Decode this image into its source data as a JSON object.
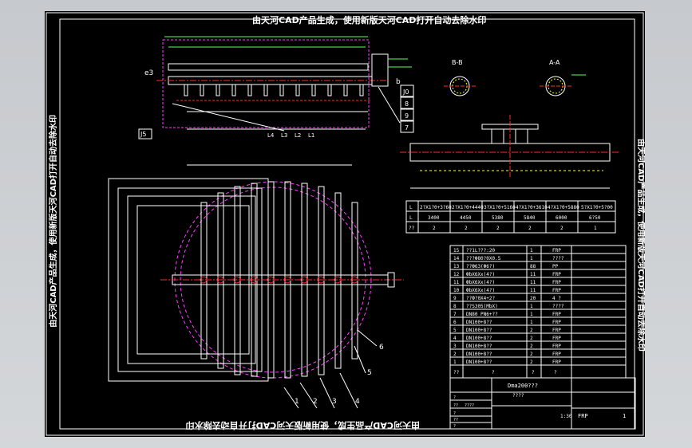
{
  "watermark": {
    "top": "由天河CAD产品生成，使用新版天河CAD打开自动去除水印",
    "bottom": "由天河CAD产品生成，使用新版天河CAD打开自动去除水印",
    "left": "由天河CAD产品生成，使用新版天河CAD打开自动去除水印",
    "right": "由天河CAD产品生成，使用新版天河CAD打开自动去除水印"
  },
  "sections": {
    "bb": "B-B",
    "aa": "A-A"
  },
  "side_labels": {
    "e3": "e3",
    "b": "b",
    "j0": "J0",
    "n8": "8",
    "n7": "7",
    "n9": "9",
    "j5": "J5",
    "l4": "L4",
    "l3": "L3",
    "l2": "L2",
    "l1": "L1"
  },
  "callouts": [
    "1",
    "2",
    "3",
    "4",
    "5",
    "6"
  ],
  "dimension_table": {
    "headers": [
      "L",
      "2?X1?0+3?60",
      "2?X1?0+4440",
      "3?X1?0+5160",
      "4?X1?0+3610",
      "4?X1?0+5880",
      "5?X1?0+5?00"
    ],
    "row1": [
      "L",
      "3400",
      "4450",
      "5380",
      "5840",
      "6000",
      "6?50"
    ],
    "row2": [
      "??",
      "2",
      "2",
      "2",
      "2",
      "2",
      "1"
    ]
  },
  "parts_list": {
    "rows": [
      {
        "no": "15",
        "name": "??1L???:20",
        "qty": "1",
        "mat": "FRP"
      },
      {
        "no": "14",
        "name": "???Ф80?0X0.5",
        "qty": "1",
        "mat": "????"
      },
      {
        "no": "13",
        "name": "??Ф63(Ф6?)",
        "qty": "88",
        "mat": "PP"
      },
      {
        "no": "12",
        "name": "ФbXбXx(4?)",
        "qty": "11",
        "mat": "FRP"
      },
      {
        "no": "11",
        "name": "ФbXбXx(4?)",
        "qty": "11",
        "mat": "FRP"
      },
      {
        "no": "10",
        "name": "ФbXбXx(4?)",
        "qty": "11",
        "mat": "FRP"
      },
      {
        "no": "9",
        "name": "??Ф?0X4+2?",
        "qty": "20",
        "mat": "4 ?"
      },
      {
        "no": "8",
        "name": "??S305(MbX)",
        "qty": "1",
        "mat": "????"
      },
      {
        "no": "7",
        "name": "DN80 PN6+??",
        "qty": "1",
        "mat": "FRP"
      },
      {
        "no": "6",
        "name": "DN100+8??",
        "qty": "1",
        "mat": "FRP"
      },
      {
        "no": "5",
        "name": "DN100+8??",
        "qty": "2",
        "mat": "FRP"
      },
      {
        "no": "4",
        "name": "DN100+8??",
        "qty": "2",
        "mat": "FRP"
      },
      {
        "no": "3",
        "name": "DN100+8??",
        "qty": "2",
        "mat": "FRP"
      },
      {
        "no": "2",
        "name": "DN100+8??",
        "qty": "2",
        "mat": "FRP"
      },
      {
        "no": "1",
        "name": "DN100+8??",
        "qty": "2",
        "mat": "FRP"
      }
    ],
    "header": {
      "no": "??",
      "name": "?",
      "qty": "?",
      "mat": "?"
    }
  },
  "title_block": {
    "drawing_no": "Dma200???",
    "drawing_sub": "????",
    "material": "FRP",
    "sheet": "1",
    "scale": "1:30",
    "small": [
      "?",
      "??",
      "????",
      "?",
      "??",
      "?"
    ]
  },
  "colors": {
    "background": "#000000",
    "line": "#ffffff",
    "centerline": "#ff2a2a",
    "hidden": "#ff3cff",
    "dimension": "#5cff5c",
    "section": "#ffff33",
    "viewer": "#cfd2d6"
  }
}
